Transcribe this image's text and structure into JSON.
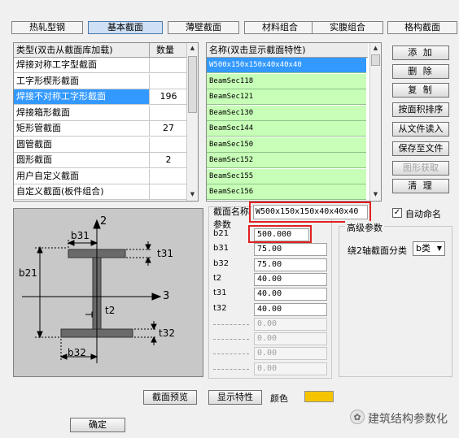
{
  "tabs": [
    "热轧型钢",
    "基本截面",
    "薄壁截面",
    "材料组合",
    "实腹组合",
    "格构截面"
  ],
  "table": {
    "headers": [
      "类型(双击从截面库加载)",
      "数量"
    ],
    "rows": [
      {
        "type": "焊接对称工字型截面",
        "count": ""
      },
      {
        "type": "工字形楔形截面",
        "count": ""
      },
      {
        "type": "焊接不对称工字形截面",
        "count": "196"
      },
      {
        "type": "焊接箱形截面",
        "count": ""
      },
      {
        "type": "矩形管截面",
        "count": "27"
      },
      {
        "type": "圆管截面",
        "count": ""
      },
      {
        "type": "圆形截面",
        "count": "2"
      },
      {
        "type": "用户自定义截面",
        "count": ""
      },
      {
        "type": "自定义截面(板件组合)",
        "count": ""
      }
    ]
  },
  "names": {
    "header": "名称(双击显示截面特性)",
    "items": [
      "W500x150x150x40x40x40",
      "BeamSec118",
      "BeamSec121",
      "BeamSec130",
      "BeamSec144",
      "BeamSec150",
      "BeamSec152",
      "BeamSec155",
      "BeamSec156"
    ]
  },
  "buttons": {
    "add": "添 加",
    "delete": "删 除",
    "copy": "复 制",
    "sort_area": "按面积排序",
    "read_file": "从文件读入",
    "save_file": "保存至文件",
    "graph_get": "图形获取",
    "clear": "清 理"
  },
  "form": {
    "name_label": "截面名称",
    "name_value": "W500x150x150x40x40x40",
    "auto_name": "自动命名",
    "auto_name_checked": true,
    "params_label": "参数",
    "params": [
      {
        "label": "b21",
        "value": "500.000"
      },
      {
        "label": "b31",
        "value": "75.00"
      },
      {
        "label": "b32",
        "value": "75.00"
      },
      {
        "label": "t2",
        "value": "40.00"
      },
      {
        "label": "t31",
        "value": "40.00"
      },
      {
        "label": "t32",
        "value": "40.00"
      }
    ],
    "disabled_values": [
      "0.00",
      "0.00",
      "0.00",
      "0.00"
    ],
    "advanced_label": "高级参数",
    "axis_label": "绕2轴截面分类",
    "axis_value": "b类"
  },
  "diagram_labels": {
    "axis2": "2",
    "axis3": "3",
    "b31": "b31",
    "t31": "t31",
    "b21": "b21",
    "t2": "t2",
    "t32": "t32",
    "b32": "b32"
  },
  "bottom": {
    "preview": "截面预览",
    "show_props": "显示特性",
    "color_label": "颜色",
    "color": "#f5c400"
  },
  "ok": "确定",
  "watermark": "建筑结构参数化",
  "colors": {
    "selected": "#3399ff",
    "name_list_bg": "#c8ffb8",
    "highlight_box": "#e02020"
  }
}
